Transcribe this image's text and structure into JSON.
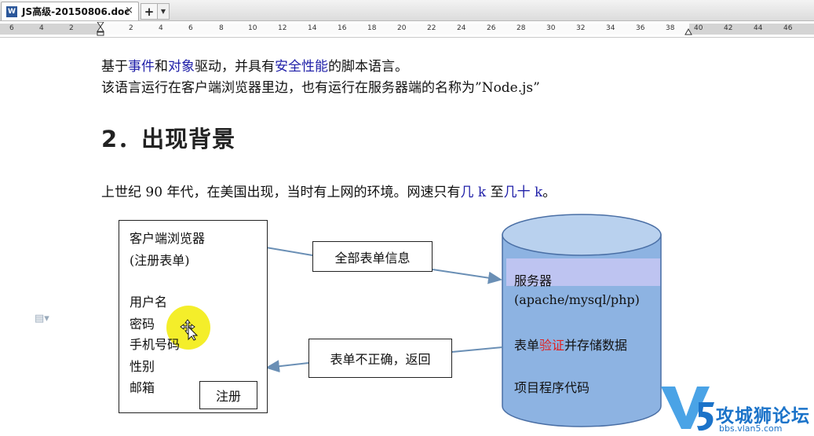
{
  "window": {
    "tab_title": "JS高级-20150806.doc",
    "tab_close": "×",
    "new_tab": "+",
    "new_tab_menu": "▼"
  },
  "ruler": {
    "labels": [
      "6",
      "4",
      "2",
      "2",
      "4",
      "6",
      "8",
      "10",
      "12",
      "14",
      "16",
      "18",
      "20",
      "22",
      "24",
      "26",
      "28",
      "30",
      "32",
      "34",
      "36",
      "38",
      "40",
      "42",
      "44",
      "46"
    ]
  },
  "document": {
    "line1": {
      "p1": "基于",
      "event": "事件",
      "p2": "和",
      "object": "对象",
      "p3": "驱动，并具有",
      "safe": "安全性能",
      "p4": "的脚本语言。"
    },
    "line2": "该语言运行在客户端浏览器里边，也有运行在服务器端的名称为”Node.js”",
    "heading": "2．出现背景",
    "line3": {
      "p1": "上世纪 90 年代，在美国出现，当时有上网的环境。网速只有",
      "k1": "几 k",
      "p2": " 至",
      "k2": "几十 k",
      "p3": "。"
    }
  },
  "diagram": {
    "client": {
      "title": "客户端浏览器",
      "subtitle": "(注册表单)",
      "fields": [
        "用户名",
        "密码",
        "手机号码",
        "性别",
        "邮箱"
      ],
      "register_button": "注册"
    },
    "arrow_to_server_label": "全部表单信息",
    "arrow_to_client_label": "表单不正确，返回",
    "server": {
      "title": "服务器",
      "stack": "(apache/mysql/php)",
      "validate_p1": "表单",
      "validate_red": "验证",
      "validate_p2": "并存储数据",
      "code": "项目程序代码"
    }
  },
  "watermark": {
    "logo": "V5",
    "name": "攻城狮论坛",
    "url": "bbs.vlan5.com"
  },
  "colors": {
    "link_blue": "#1f1fa8",
    "highlight_red": "#e02020",
    "cylinder_fill": "#8db3e2",
    "arrow": "#6a8fb5",
    "cursor_highlight": "#f4ee2a",
    "watermark_blue": "#1b73c9"
  }
}
